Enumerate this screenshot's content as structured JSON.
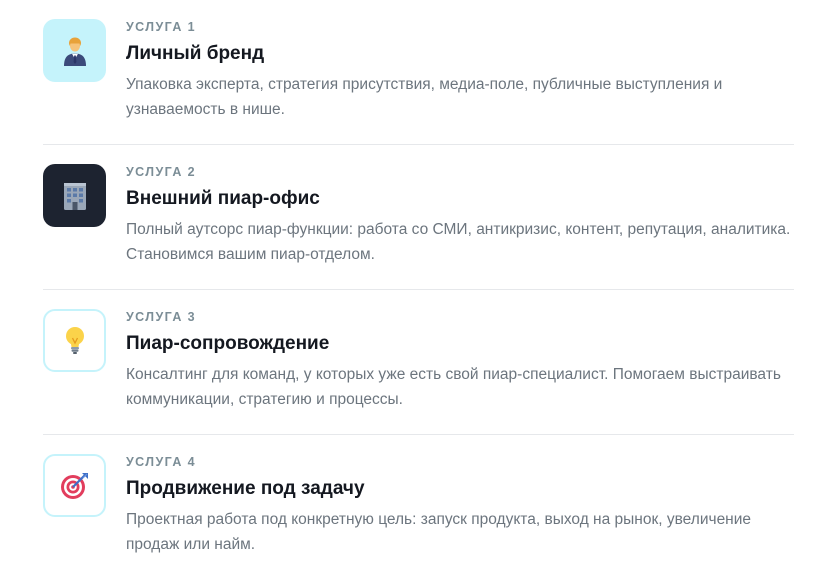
{
  "services": [
    {
      "label": "УСЛУГА 1",
      "title": "Личный бренд",
      "description": "Упаковка эксперта, стратегия присутствия, медиа-поле, публичные выступления и узнаваемость в нише.",
      "icon": "businessman-icon",
      "icon_bg": "#c5f3fb"
    },
    {
      "label": "УСЛУГА 2",
      "title": "Внешний пиар-офис",
      "description": "Полный аутсорс пиар-функции: работа со СМИ, антикризис, контент, репутация, аналитика. Становимся вашим пиар-отделом.",
      "icon": "office-building-icon",
      "icon_bg": "#1d2330"
    },
    {
      "label": "УСЛУГА 3",
      "title": "Пиар-сопровождение",
      "description": "Консалтинг для команд, у которых уже есть свой пиар-специалист. Помогаем выстраивать коммуникации, стратегию и процессы.",
      "icon": "light-bulb-icon",
      "icon_bg": "#ffffff"
    },
    {
      "label": "УСЛУГА 4",
      "title": "Продвижение под задачу",
      "description": "Проектная работа под конкретную цель: запуск продукта, выход на рынок, увеличение продаж или найм.",
      "icon": "target-icon",
      "icon_bg": "#ffffff"
    }
  ]
}
